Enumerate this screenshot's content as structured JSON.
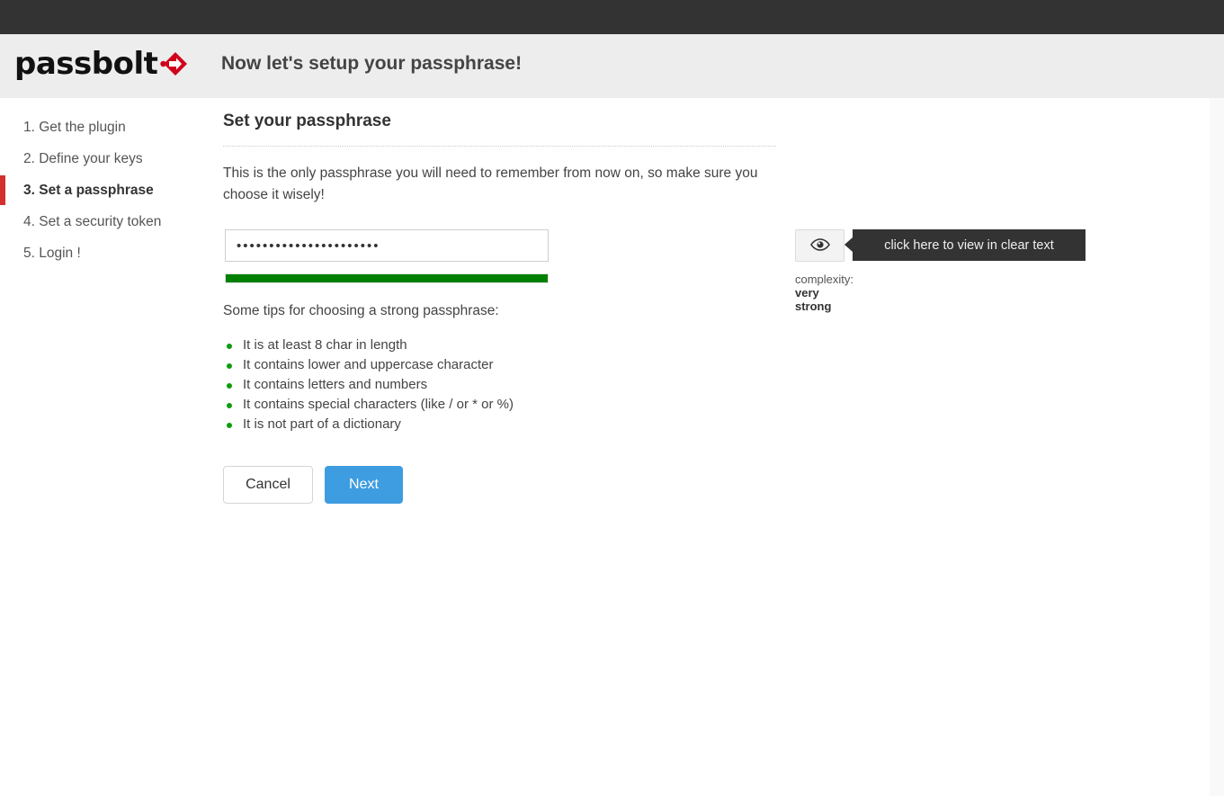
{
  "brand": {
    "logo_text": "passbolt",
    "logo_mark": "red-diamond-arrow",
    "accent_red": "#d32f2f",
    "accent_blue": "#3e9ce0",
    "accent_green": "#008000"
  },
  "header": {
    "title": "Now let's setup your passphrase!"
  },
  "sidebar": {
    "items": [
      {
        "label": "1. Get the plugin",
        "active": false
      },
      {
        "label": "2. Define your keys",
        "active": false
      },
      {
        "label": "3. Set a passphrase",
        "active": true
      },
      {
        "label": "4. Set a security token",
        "active": false
      },
      {
        "label": "5. Login !",
        "active": false
      }
    ]
  },
  "main": {
    "panel_title": "Set your passphrase",
    "intro": "This is the only passphrase you will need to remember from now on, so make sure you choose it wisely!",
    "password": {
      "masked_value": "......................",
      "placeholder": "",
      "dot_count": 22
    },
    "strength": {
      "percent": 100,
      "label_prefix": "complexity:",
      "label_value": "very strong",
      "color": "#008000"
    },
    "reveal": {
      "icon": "eye-icon",
      "tooltip": "click here to view in clear text"
    },
    "tips_title": "Some tips for choosing a strong passphrase:",
    "tips": [
      "It is at least 8 char in length",
      "It contains lower and uppercase character",
      "It contains letters and numbers",
      "It contains special characters (like / or * or %)",
      "It is not part of a dictionary"
    ],
    "actions": {
      "cancel_label": "Cancel",
      "next_label": "Next"
    }
  }
}
